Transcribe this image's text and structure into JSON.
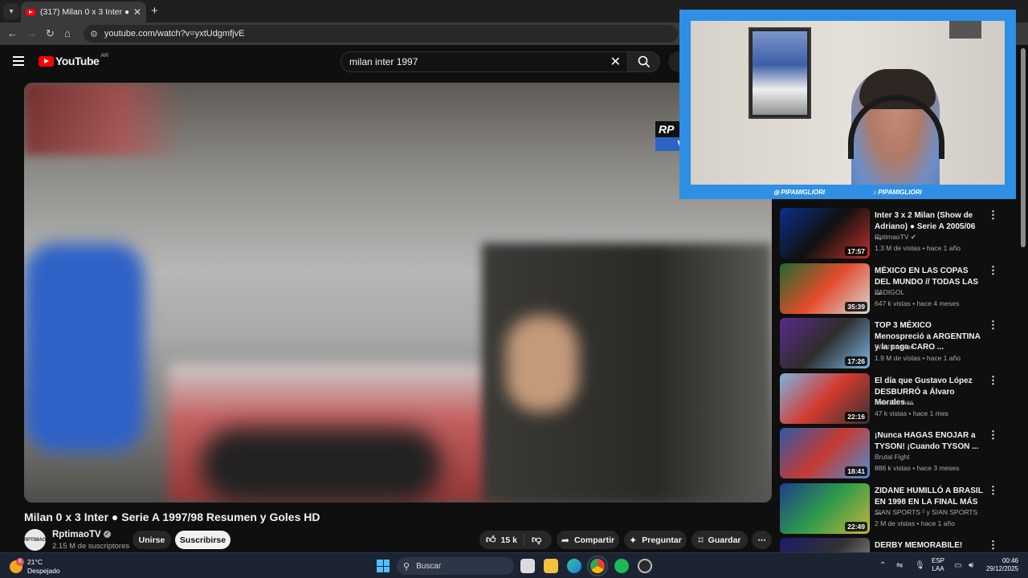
{
  "browser": {
    "tab_title": "(317) Milan 0 x 3 Inter ● Serie A",
    "url": "youtube.com/watch?v=yxtUdgmfjvE"
  },
  "youtube": {
    "logo": "YouTube",
    "country": "AR",
    "search_query": "milan inter  1997"
  },
  "video": {
    "title": "Milan 0 x 3 Inter ● Serie A 1997/98 Resumen y Goles HD",
    "watermark_top": "RP",
    "watermark_bottom": "V",
    "channel": "RptimaoTV",
    "avatar_text": "RPTIMAO",
    "subscribers": "2.15 M de suscriptores",
    "join": "Unirse",
    "subscribe": "Suscribirse",
    "likes": "15 k",
    "share": "Compartir",
    "ask": "Preguntar",
    "save": "Guardar"
  },
  "webcam": {
    "instagram": "PIPAMIGLIORI",
    "tiktok": "PIPAMIGLIORI"
  },
  "recommendations": [
    {
      "title": "Inter 3 x 2 Milan (Show de Adriano) ● Serie A 2005/06 ...",
      "channel": "RptimaoTV",
      "meta": "1.3 M de vistas • hace 1 año",
      "duration": "17:57",
      "colors": [
        "#0b2f8a",
        "#111",
        "#c0302a"
      ]
    },
    {
      "title": "MÉXICO EN LAS COPAS DEL MUNDO // TODAS LAS ...",
      "channel": "PADIGOL",
      "meta": "647 k vistas • hace 4 meses",
      "duration": "35:39",
      "colors": [
        "#1f6b2e",
        "#e34b2b",
        "#d8d8d8"
      ]
    },
    {
      "title": "TOP 3 MÉXICO Menospreció a ARGENTINA y la paga CARO ...",
      "channel": "Washito Man",
      "meta": "1.9 M de vistas • hace 1 año",
      "duration": "17:26",
      "colors": [
        "#5b2a8a",
        "#2d2d2d",
        "#7ab8e6"
      ]
    },
    {
      "title": "El día que Gustavo López DESBURRÓ a Álvaro Morales ...",
      "channel": "Alex Cannas",
      "meta": "47 k vistas • hace 1 mes",
      "duration": "22:16",
      "colors": [
        "#7db3e0",
        "#d43a2f",
        "#333"
      ]
    },
    {
      "title": "¡Nunca HAGAS ENOJAR a TYSON! ¡Cuando TYSON ...",
      "channel": "Brutal Fight",
      "meta": "886 k vistas • hace 3 meses",
      "duration": "18:41",
      "colors": [
        "#2f5aa8",
        "#c73a32",
        "#4a8fd6"
      ]
    },
    {
      "title": "ZIDANE HUMILLÓ A BRASIL EN 1998 EN LA FINAL MÁS ...",
      "channel": "SIAN SPORTS ² y SIAN SPORTS",
      "meta": "2 M de vistas • hace 1 año",
      "duration": "22:49",
      "colors": [
        "#1e3f8a",
        "#2f9c4a",
        "#c9b33a"
      ]
    },
    {
      "title": "DERBY MEMORABILE! ETO'O vs",
      "channel": "",
      "meta": "",
      "duration": "",
      "colors": [
        "#1a1a6a",
        "#333",
        "#aaa"
      ]
    }
  ],
  "taskbar": {
    "temperature": "21°C",
    "weather": "Despejado",
    "weather_badge": "6",
    "search": "Buscar",
    "lang_top": "ESP",
    "lang_bottom": "LAA",
    "time": "00:46",
    "date": "29/12/2025"
  },
  "colors": {
    "youtube_red": "#ff0000",
    "cam_border": "#2e8fe4",
    "windows_accent": "#4cc2ff"
  }
}
